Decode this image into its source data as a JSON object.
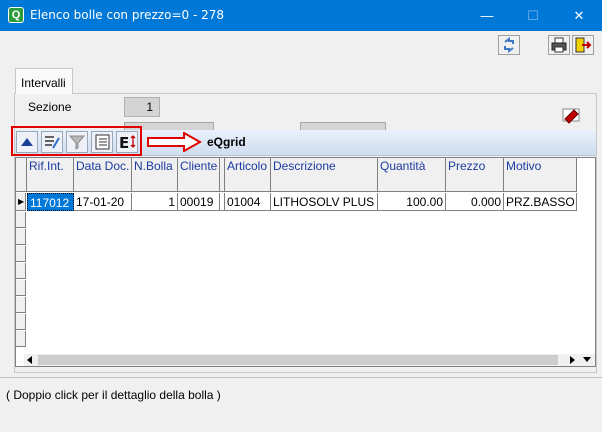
{
  "window": {
    "title": "Elenco bolle con prezzo=0 - 278",
    "app_icon_letter": "Q",
    "minimize": "—",
    "maximize": "☐",
    "close": "✕"
  },
  "toolbar": {
    "buttons": [
      {
        "name": "refresh-icon"
      },
      {
        "name": "print-icon"
      },
      {
        "name": "exit-icon"
      }
    ]
  },
  "tab": {
    "label": "Intervalli"
  },
  "filters": {
    "sezione_label": "Sezione",
    "sezione_value": "1"
  },
  "grid_toolbar": {
    "buttons": [
      {
        "name": "sort-up-icon"
      },
      {
        "name": "edit-columns-icon"
      },
      {
        "name": "filter-icon"
      },
      {
        "name": "list-settings-icon"
      },
      {
        "name": "export-icon"
      }
    ],
    "grid_name": "eQgrid"
  },
  "grid": {
    "columns": [
      "Rif.Int.",
      "Data Doc.",
      "N.Bolla",
      "Cliente",
      "Articolo",
      "Descrizione",
      "Quantità",
      "Prezzo",
      "Motivo"
    ],
    "rows": [
      [
        "117012",
        "17-01-20",
        "1",
        "00019",
        "01004",
        "LITHOSOLV PLUS",
        "100.00",
        "0.000",
        "PRZ.BASSO"
      ]
    ]
  },
  "status": {
    "text": "( Doppio click per il dettaglio della bolla )"
  },
  "colors": {
    "titlebar": "#0078d7",
    "highlight_border": "#e00000",
    "header_text": "#1a3aa0"
  }
}
